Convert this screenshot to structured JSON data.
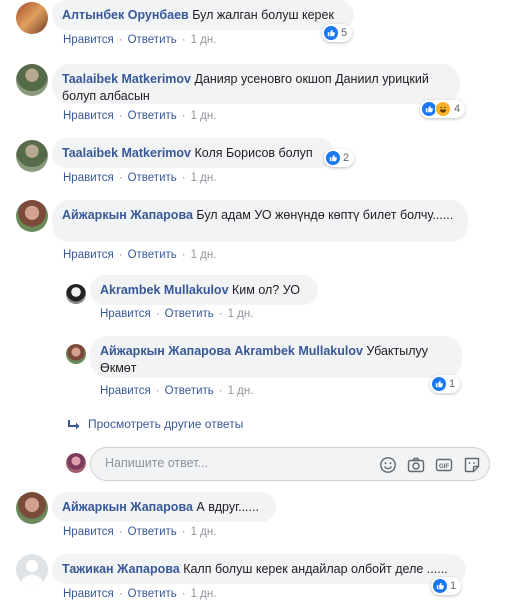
{
  "comments": [
    {
      "name": "Алтынбек Орунбаев",
      "text": "Бул жалган болуш керек",
      "like": "Нравится",
      "reply": "Ответить",
      "time": "1 дн.",
      "reactions": "5"
    },
    {
      "name": "Taalaibek Matkerimov",
      "text": "Данияр усеновго окшоп Даниил урицкий болуп албасын",
      "like": "Нравится",
      "reply": "Ответить",
      "time": "1 дн.",
      "reactions": "4"
    },
    {
      "name": "Taalaibek Matkerimov",
      "text": "Коля Борисов болуп",
      "like": "Нравится",
      "reply": "Ответить",
      "time": "1 дн.",
      "reactions": "2"
    },
    {
      "name": "Айжаркын Жапарова",
      "text": "Бул адам УО жөнүндө көптү билет болчу......",
      "like": "Нравится",
      "reply": "Ответить",
      "time": "1 дн."
    },
    {
      "name": "Айжаркын Жапарова",
      "text": "А вдруг......",
      "like": "Нравится",
      "reply": "Ответить",
      "time": "1 дн."
    },
    {
      "name": "Тажикан Жапарова",
      "text": "Калп болуш керек андайлар олбойт деле ......",
      "like": "Нравится",
      "reply": "Ответить",
      "time": "1 дн.",
      "reactions": "1"
    }
  ],
  "replies": [
    {
      "name": "Akrambek Mullakulov",
      "text": "Ким ол? УО",
      "like": "Нравится",
      "reply": "Ответить",
      "time": "1 дн."
    },
    {
      "name": "Айжаркын Жапарова",
      "mention": "Akrambek Mullakulov",
      "text": "Убактылуу Өкмөт",
      "like": "Нравится",
      "reply": "Ответить",
      "time": "1 дн.",
      "reactions": "1"
    }
  ],
  "more_replies": "Просмотреть другие ответы",
  "reply_input": {
    "placeholder": "Напишите ответ..."
  },
  "icons": [
    "emoji-icon",
    "camera-icon",
    "gif-icon",
    "sticker-icon"
  ],
  "colors": {
    "link": "#385898",
    "bubble": "#f2f3f5",
    "like": "#1877f2",
    "meta": "#90949c"
  }
}
